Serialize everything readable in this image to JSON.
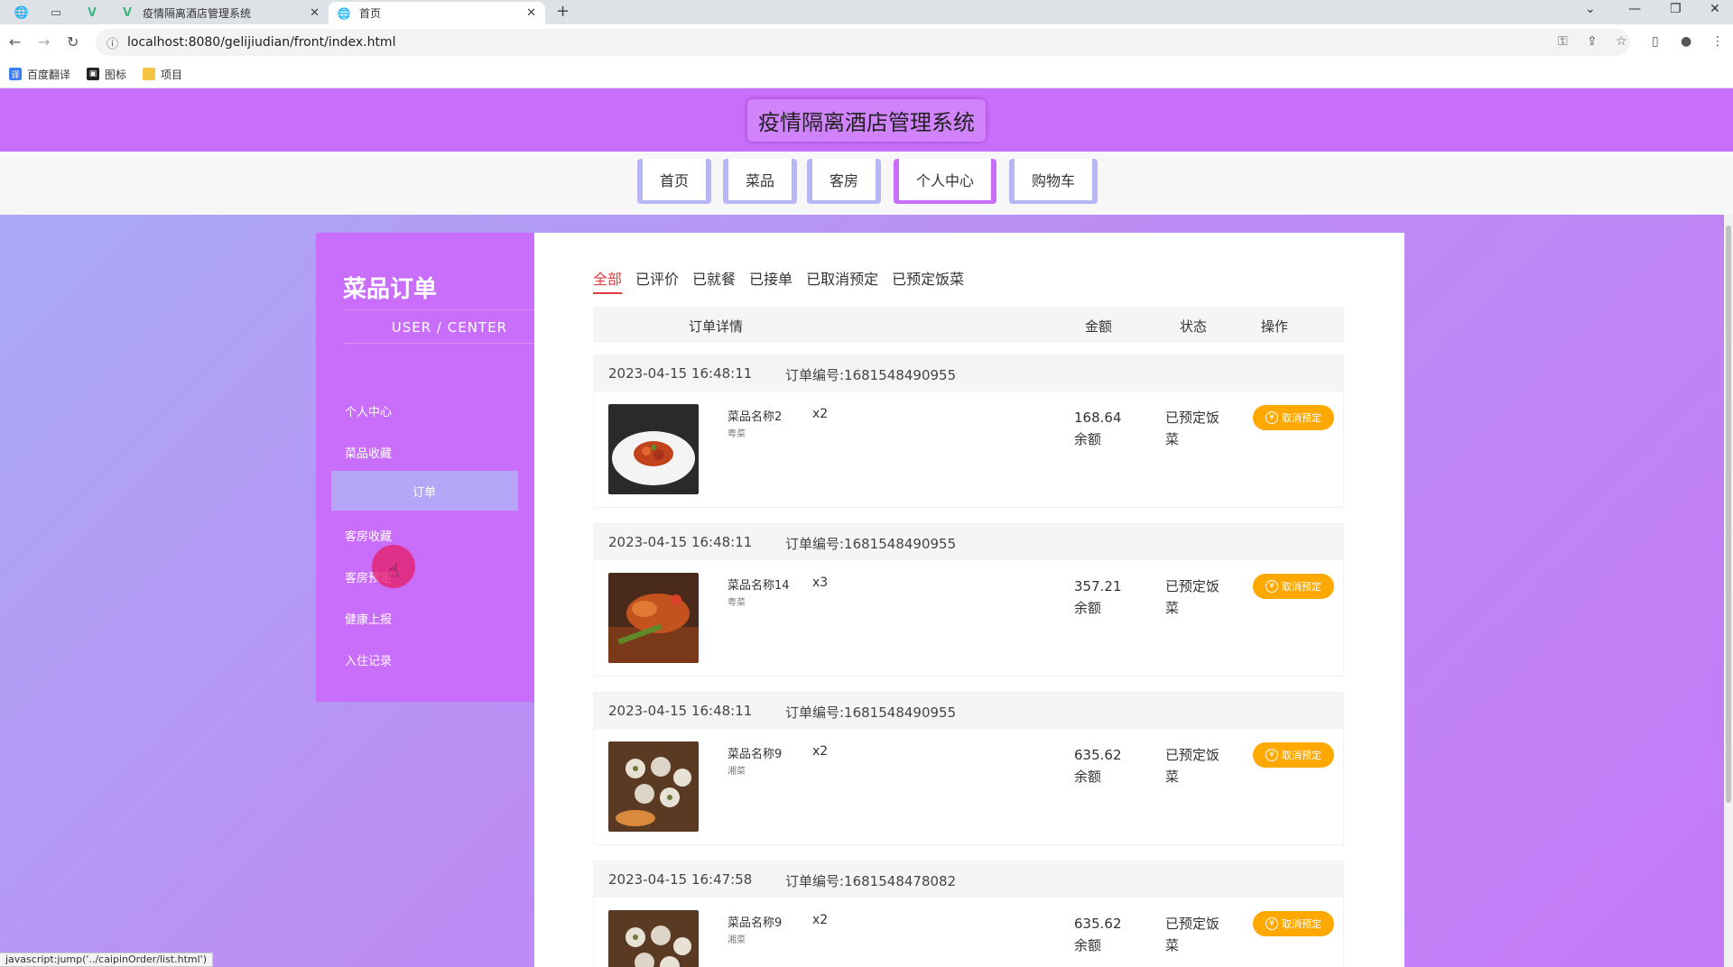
{
  "browser": {
    "tabs": [
      {
        "title": "疫情隔离酒店管理系统",
        "favicon": "vue-icon"
      },
      {
        "title": "首页",
        "favicon": "globe-icon"
      }
    ],
    "url": "localhost:8080/gelijiudian/front/index.html",
    "bookmarks": [
      {
        "label": "百度翻译",
        "color": "#3d7ef7"
      },
      {
        "label": "图标",
        "color": "#222222"
      },
      {
        "label": "项目",
        "color": "#f5c542"
      }
    ],
    "status_url": "javascript:jump('../caipinOrder/list.html')"
  },
  "site": {
    "title": "疫情隔离酒店管理系统",
    "nav": [
      "首页",
      "菜品",
      "客房",
      "个人中心",
      "购物车"
    ],
    "nav_active": "个人中心",
    "accent": "#c86efb"
  },
  "sidebar": {
    "title": "菜品订单",
    "subtitle": "USER / CENTER",
    "items": [
      "个人中心",
      "菜品收藏",
      "订单",
      "客房收藏",
      "客房预定",
      "健康上报",
      "入住记录"
    ],
    "active_index": 2
  },
  "filters": {
    "items": [
      "全部",
      "已评价",
      "已就餐",
      "已接单",
      "已取消预定",
      "已预定饭菜"
    ],
    "active_index": 0,
    "active_color": "#e0393e"
  },
  "table": {
    "headers": [
      "订单详情",
      "金额",
      "状态",
      "操作"
    ]
  },
  "orders": [
    {
      "time": "2023-04-15 16:48:11",
      "order_no": "订单编号:1681548490955",
      "dish": "菜品名称2",
      "category": "粤菜",
      "qty": "x2",
      "amount": "168.64",
      "pay": "余额",
      "status": "已预定饭菜",
      "action": "取消预定"
    },
    {
      "time": "2023-04-15 16:48:11",
      "order_no": "订单编号:1681548490955",
      "dish": "菜品名称14",
      "category": "粤菜",
      "qty": "x3",
      "amount": "357.21",
      "pay": "余额",
      "status": "已预定饭菜",
      "action": "取消预定"
    },
    {
      "time": "2023-04-15 16:48:11",
      "order_no": "订单编号:1681548490955",
      "dish": "菜品名称9",
      "category": "湘菜",
      "qty": "x2",
      "amount": "635.62",
      "pay": "余额",
      "status": "已预定饭菜",
      "action": "取消预定"
    },
    {
      "time": "2023-04-15 16:47:58",
      "order_no": "订单编号:1681548478082",
      "dish": "菜品名称9",
      "category": "湘菜",
      "qty": "x2",
      "amount": "635.62",
      "pay": "余额",
      "status": "已预定饭菜",
      "action": "取消预定"
    }
  ]
}
